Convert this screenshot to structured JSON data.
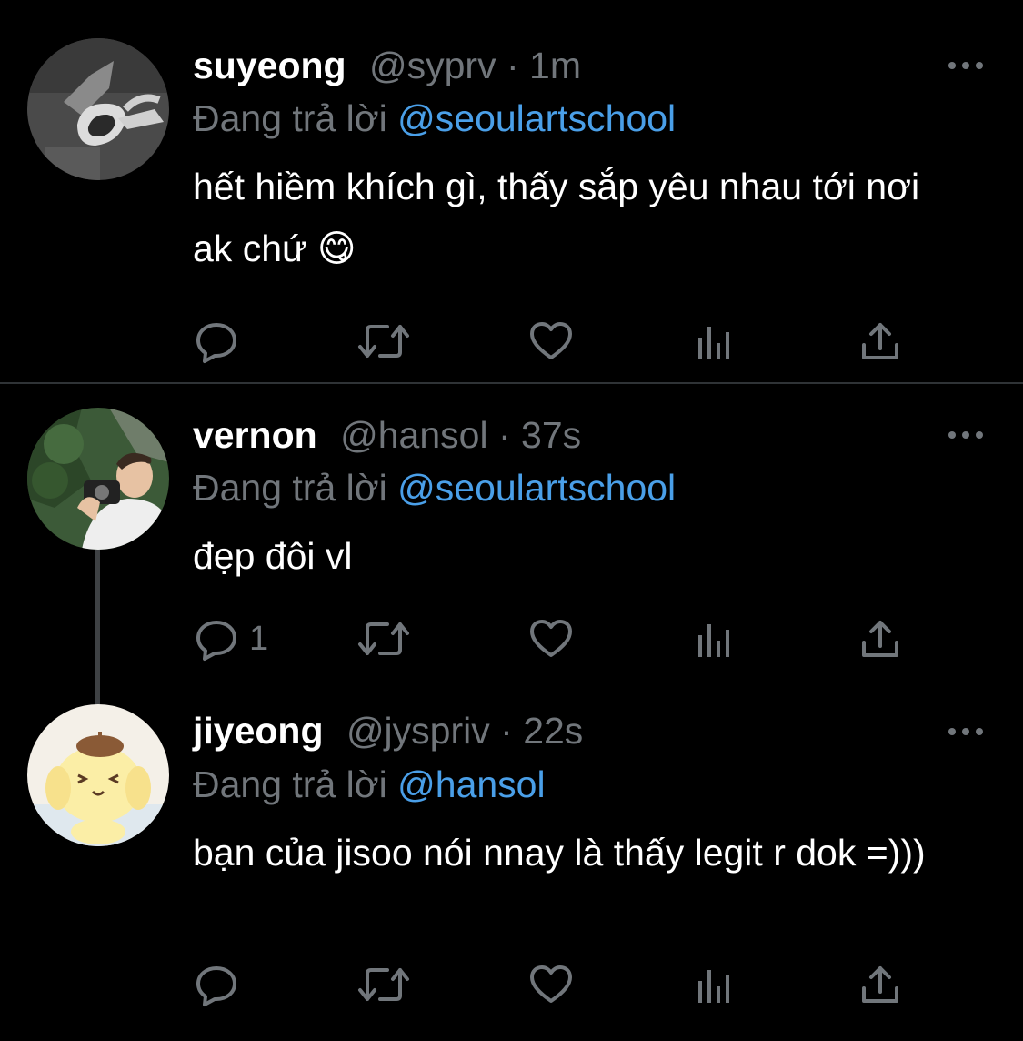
{
  "tweets": [
    {
      "name": "suyeong",
      "handle": "@syprv",
      "dot": "·",
      "time": "1m",
      "replying_label": "Đang trả lời",
      "replying_to": "@seoulartschool",
      "text": "hết hiềm khích gì, thấy sắp yêu nhau tới nơi ak chứ 😋",
      "reply_count": "",
      "avatar": "sunglasses-avatar"
    },
    {
      "name": "vernon",
      "handle": "@hansol",
      "dot": "·",
      "time": "37s",
      "replying_label": "Đang trả lời",
      "replying_to": "@seoulartschool",
      "text": "đẹp đôi vl",
      "reply_count": "1",
      "avatar": "camera-photo-avatar"
    },
    {
      "name": "jiyeong",
      "handle": "@jyspriv",
      "dot": "·",
      "time": "22s",
      "replying_label": "Đang trả lời",
      "replying_to": "@hansol",
      "text": "bạn của jisoo nói nnay là thấy legit r dok =)))",
      "reply_count": "",
      "avatar": "pompompurin-avatar"
    }
  ],
  "icons": [
    "reply-icon",
    "retweet-icon",
    "like-icon",
    "analytics-icon",
    "share-icon",
    "more-icon"
  ],
  "colors": {
    "background": "#000000",
    "text": "#ffffff",
    "secondary": "#71767b",
    "mention": "#4a9fe8",
    "divider": "#2f3336"
  }
}
